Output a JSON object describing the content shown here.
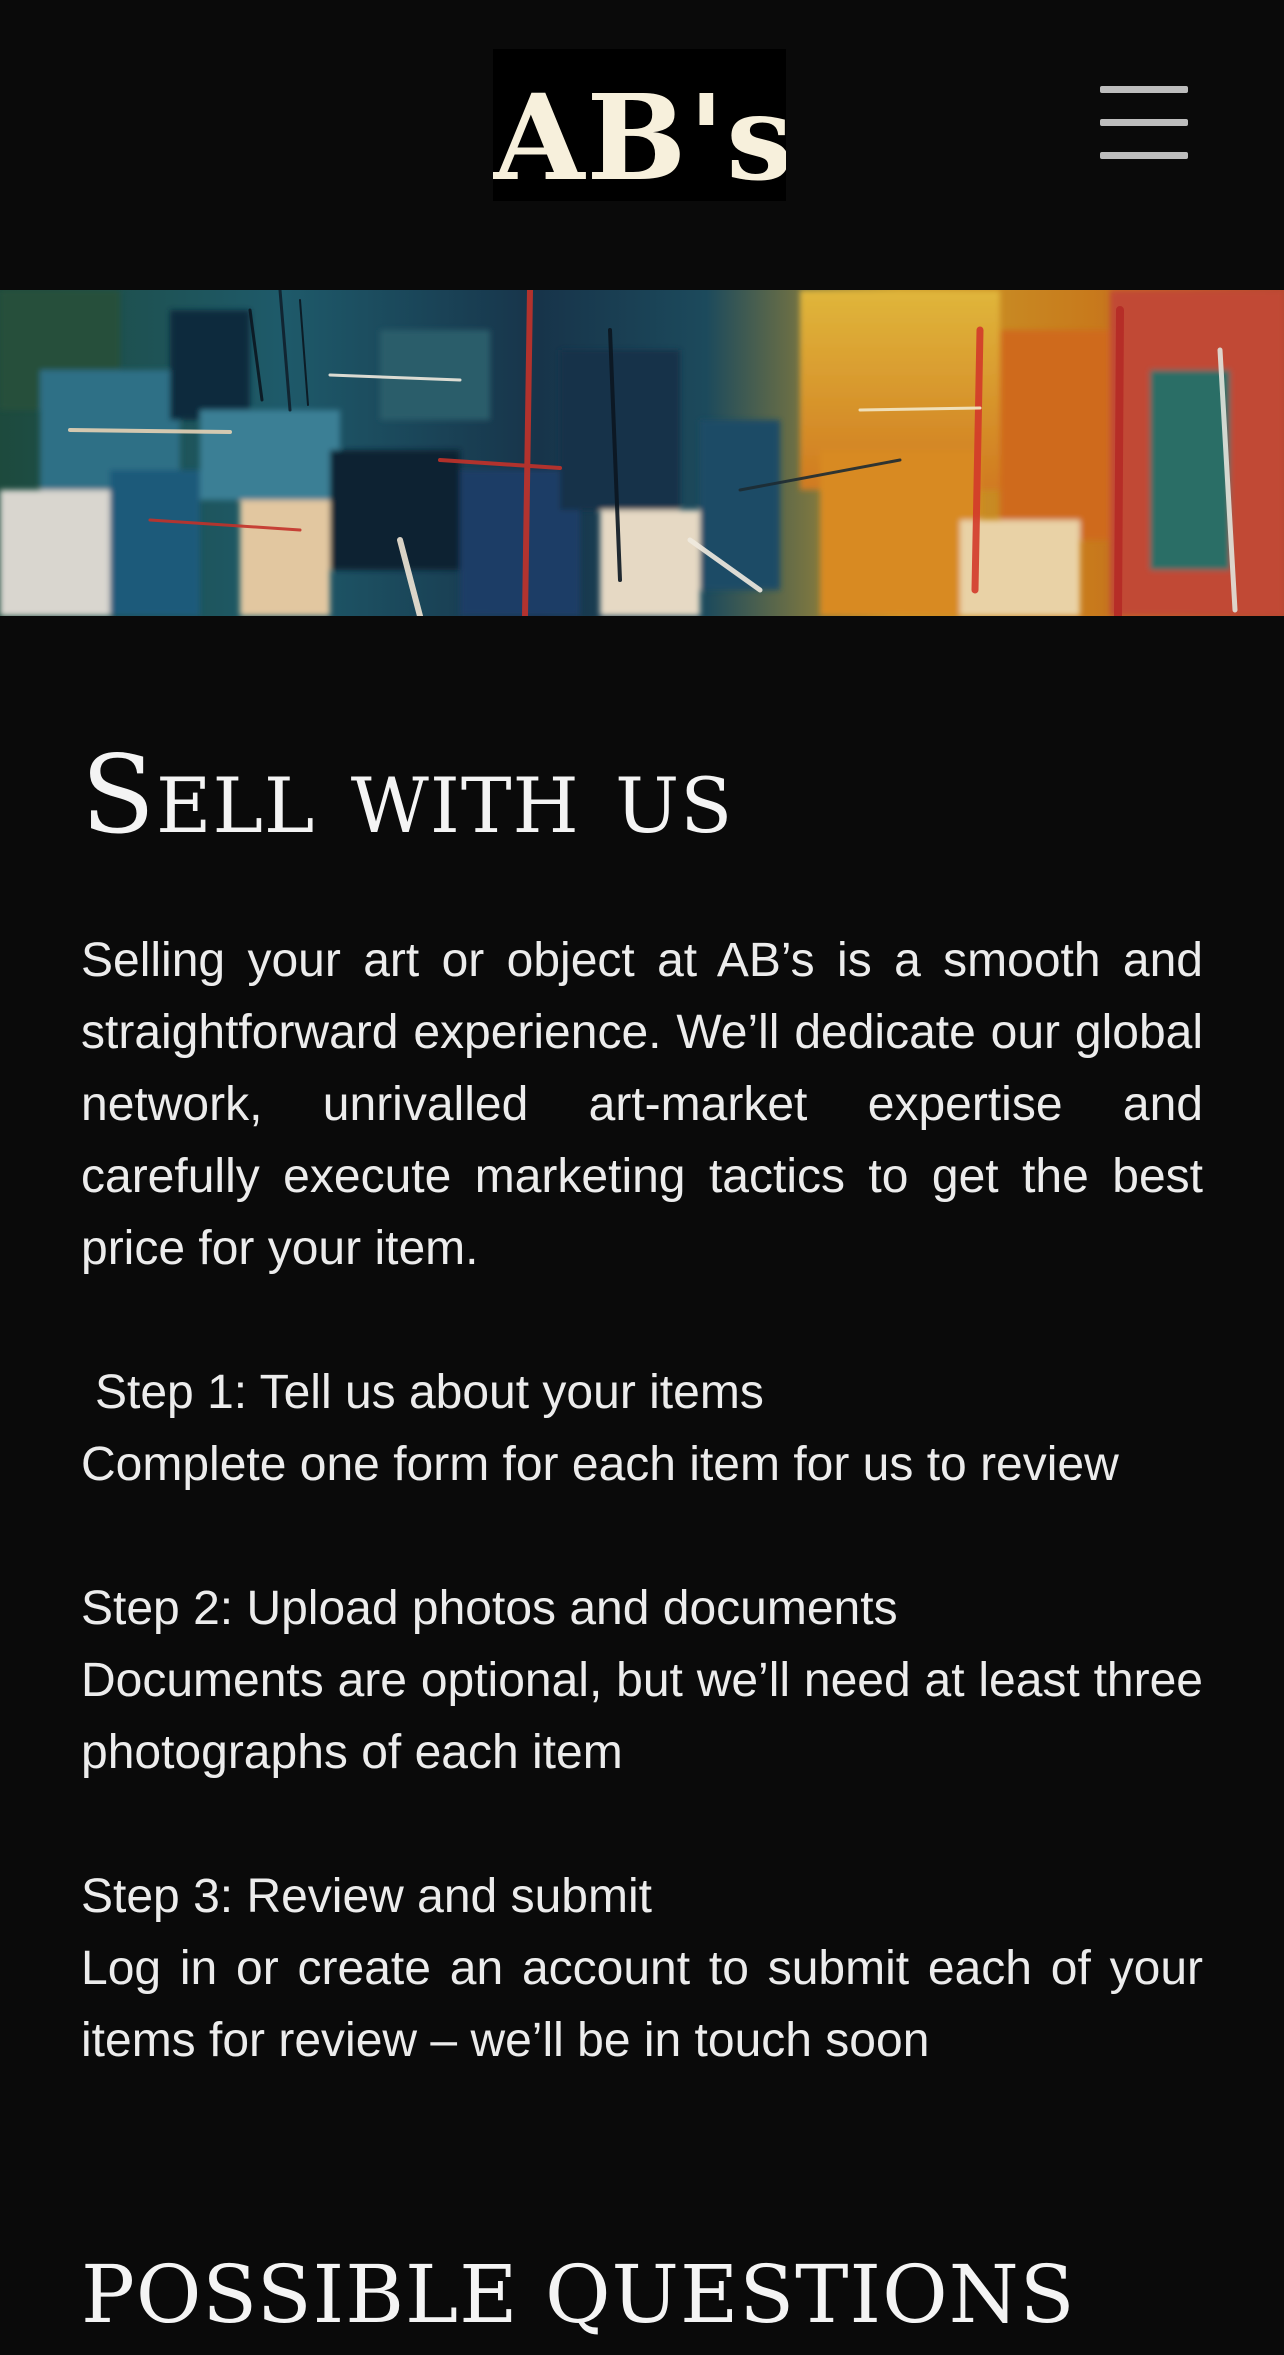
{
  "header": {
    "logo_text": "AB's",
    "menu_icon": "hamburger-menu-icon"
  },
  "banner": {
    "description_icon": "abstract-painting-banner"
  },
  "main": {
    "title": "Sell with us",
    "intro": "Selling your art or object at AB’s is a smooth and straightforward experience. We’ll dedicate our global network, unrivalled art-market expertise and carefully execute marketing tactics to get the best price for your item.",
    "steps": [
      {
        "heading": "Step 1: Tell us about your items",
        "body": "Complete one form for each item for us to review"
      },
      {
        "heading": "Step 2: Upload photos and documents",
        "body": "Documents are optional, but we’ll need at least three photographs of each item"
      },
      {
        "heading": "Step 3: Review and submit",
        "body": "Log in or create an account to submit each of your items for review – we’ll be in touch soon"
      }
    ],
    "questions_title": "POSSIBLE QUESTIONS"
  },
  "colors": {
    "background": "#0a0a0a",
    "text": "#ececec",
    "logo_text": "#f7f0dc",
    "menu_icon": "#bdbdbd"
  }
}
